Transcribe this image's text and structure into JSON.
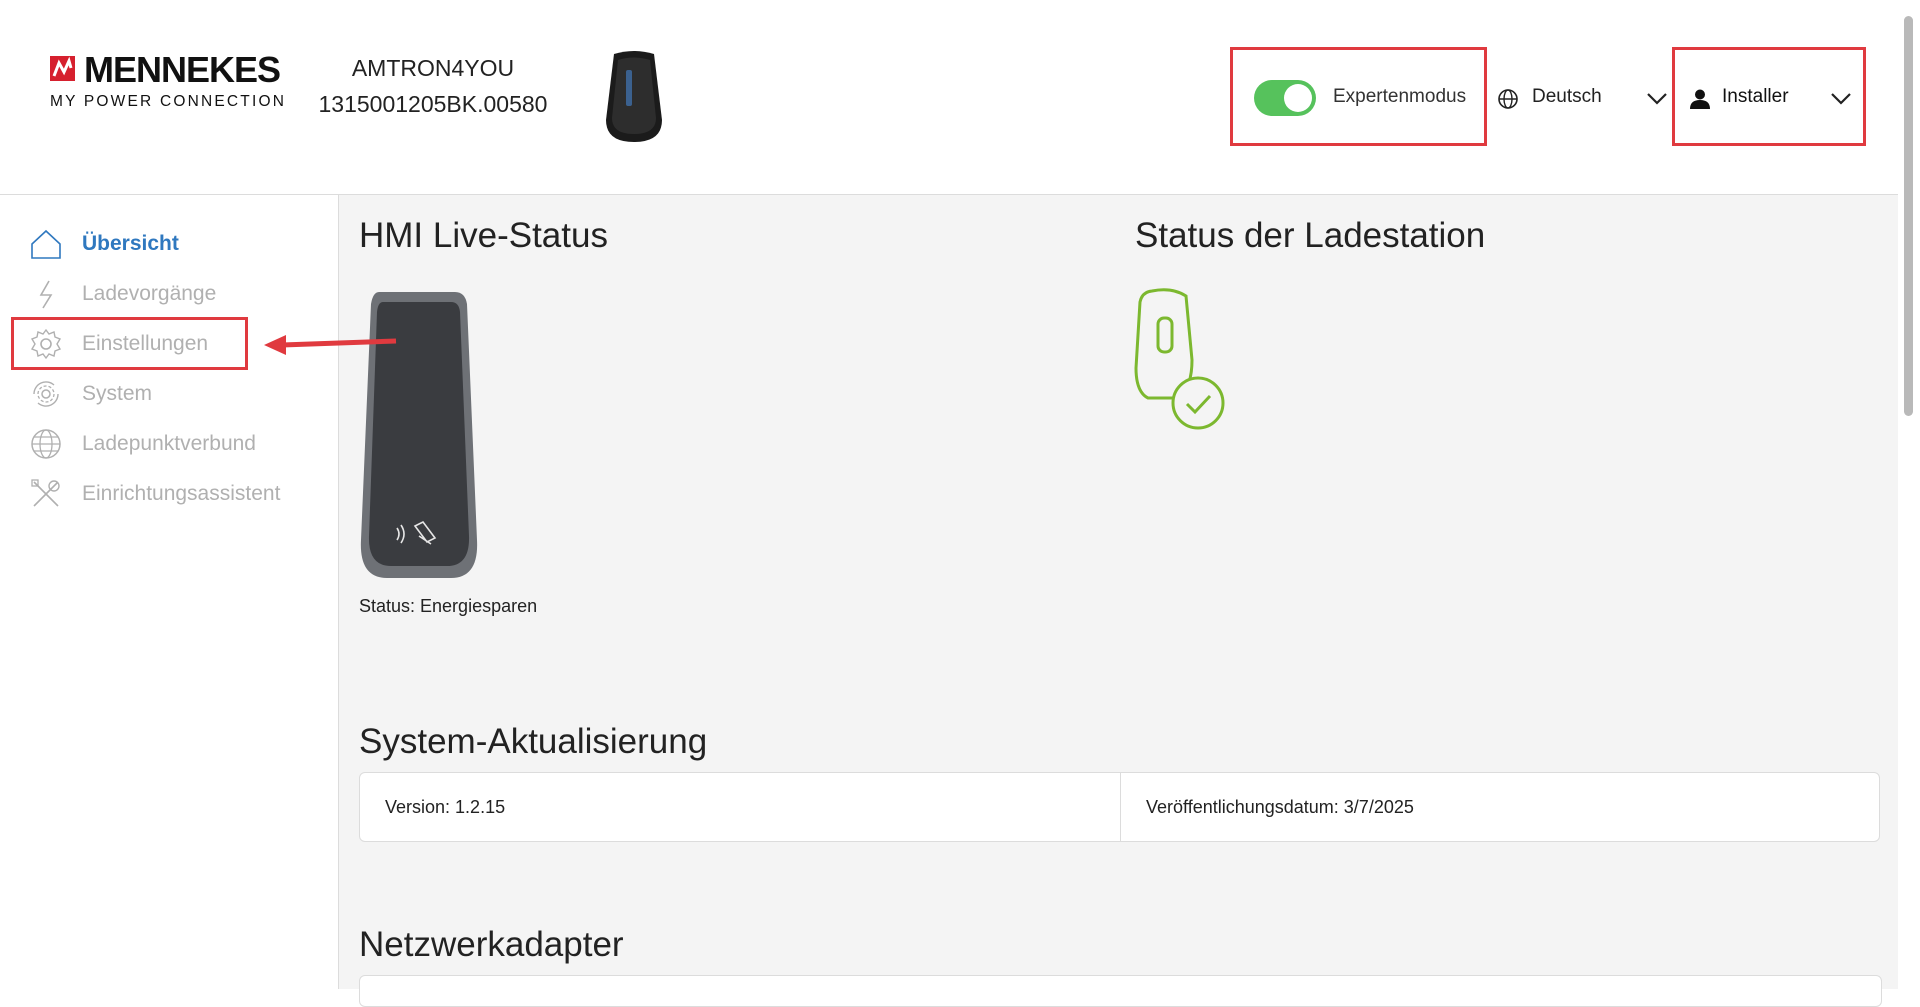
{
  "brand": {
    "name": "MENNEKES",
    "tagline": "MY POWER CONNECTION"
  },
  "device": {
    "model": "AMTRON4YOU",
    "serial": "1315001205BK.00580"
  },
  "header": {
    "expert_mode_label": "Expertenmodus",
    "expert_mode_on": true,
    "language": "Deutsch",
    "user_role": "Installer"
  },
  "sidebar": {
    "items": [
      {
        "label": "Übersicht",
        "icon": "home-icon",
        "active": true
      },
      {
        "label": "Ladevorgänge",
        "icon": "lightning-icon",
        "active": false
      },
      {
        "label": "Einstellungen",
        "icon": "gear-icon",
        "active": false
      },
      {
        "label": "System",
        "icon": "system-gear-icon",
        "active": false
      },
      {
        "label": "Ladepunktverbund",
        "icon": "globe-icon",
        "active": false
      },
      {
        "label": "Einrichtungsassistent",
        "icon": "tools-icon",
        "active": false
      }
    ]
  },
  "main": {
    "hmi_title": "HMI Live-Status",
    "hmi_status": "Status: Energiesparen",
    "station_title": "Status der Ladestation",
    "update_title": "System-Aktualisierung",
    "version": "Version: 1.2.15",
    "release_date": "Veröffentlichungsdatum: 3/7/2025",
    "network_title": "Netzwerkadapter"
  },
  "colors": {
    "accent_blue": "#2f78bf",
    "toggle_green": "#56c25c",
    "station_green": "#7cb82f",
    "annotation_red": "#e03a3f",
    "brand_red": "#d6202e"
  }
}
